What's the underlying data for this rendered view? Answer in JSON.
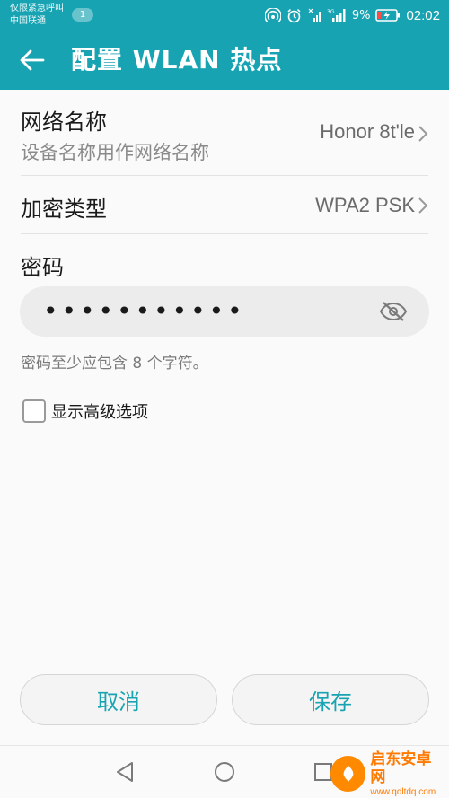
{
  "status_bar": {
    "line1": "仅限紧急呼叫",
    "line2": "中国联通",
    "badge": "1",
    "battery": "9%",
    "time": "02:02",
    "icons": [
      "hotspot-icon",
      "alarm-icon",
      "signal-icon",
      "signal-3g-icon",
      "battery-icon"
    ]
  },
  "app_bar": {
    "back_icon": "arrow-left-icon",
    "title": "配置 WLAN 热点"
  },
  "network_name": {
    "label": "网络名称",
    "sub": "设备名称用作网络名称",
    "value": "Honor 8t'le"
  },
  "encryption": {
    "label": "加密类型",
    "value": "WPA2 PSK"
  },
  "password": {
    "label": "密码",
    "masked_value": "•••••••••••",
    "toggle_icon": "eye-off-icon",
    "hint": "密码至少应包含 8 个字符。"
  },
  "advanced": {
    "label": "显示高级选项",
    "checked": false
  },
  "buttons": {
    "cancel": "取消",
    "save": "保存"
  },
  "watermark": {
    "title": "启东安卓网",
    "url": "www.qdltdq.com"
  },
  "colors": {
    "accent": "#18a3b2",
    "watermark": "#ff7a00"
  }
}
